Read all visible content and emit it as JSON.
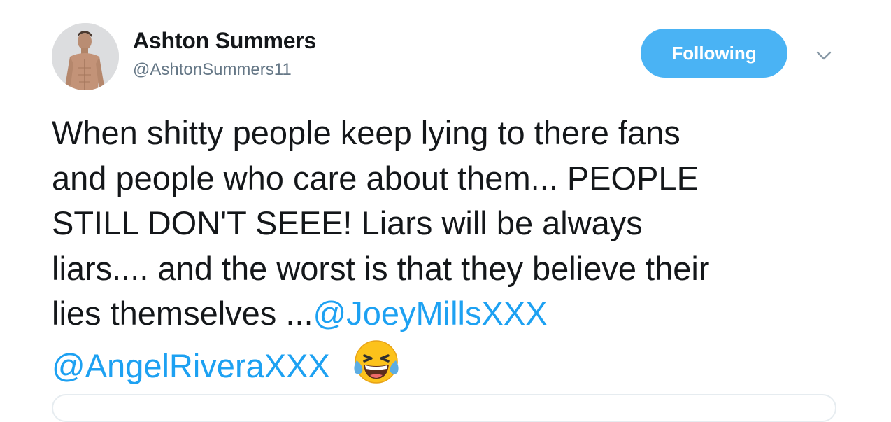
{
  "author": {
    "name": "Ashton Summers",
    "handle": "@AshtonSummers11"
  },
  "follow_button": {
    "label": "Following"
  },
  "tweet": {
    "line1": "When shitty people keep lying to there fans",
    "line2": "and people who care about them... PEOPLE",
    "line3": "STILL DON'T SEEE! Liars will be always",
    "line4": "liars.... and the worst is that they believe their",
    "line5_text": "lies themselves ...",
    "mention1": "@JoeyMillsXXX",
    "mention2": "@AngelRiveraXXX",
    "emoji": "face-with-tears-of-joy"
  },
  "icons": {
    "more": "chevron-down-icon"
  },
  "colors": {
    "follow_button": "#4ab3f4",
    "mention": "#1da1f2",
    "handle": "#657786",
    "text": "#14171a"
  }
}
